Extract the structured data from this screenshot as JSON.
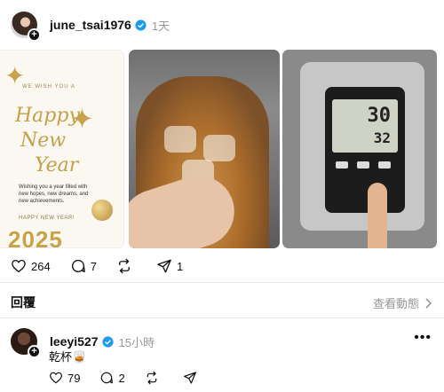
{
  "post": {
    "username": "june_tsai1976",
    "time": "1天",
    "likes": "264",
    "comments": "7",
    "shares": "1"
  },
  "newyear_card": {
    "small": "WE WISH YOU A",
    "line1": "Happy",
    "line2": "New",
    "line3": "Year",
    "body": "Wishing you a year filled with new hopes, new dreams, and new achievements.",
    "happy": "HAPPY NEW YEAR!",
    "year": "2025"
  },
  "scale": {
    "reading1": "30",
    "reading2": "32"
  },
  "replies": {
    "title": "回覆",
    "activity_link": "查看動態"
  },
  "reply": {
    "username": "leeyi527",
    "time": "15小時",
    "text": "乾杯🥃",
    "likes": "79",
    "comments": "2"
  },
  "colors": {
    "verified": "#1d9bf0",
    "muted": "#999999",
    "gold": "#c9a247"
  }
}
